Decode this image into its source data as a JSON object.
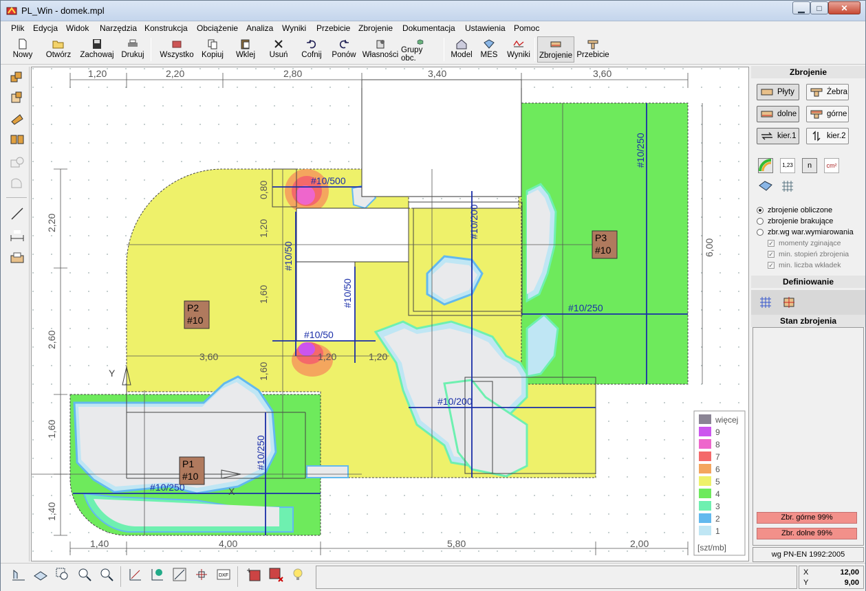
{
  "window": {
    "title": "PL_Win - domek.mpl",
    "min_glyph": "▁",
    "max_glyph": "□",
    "close_glyph": "✕"
  },
  "menu": [
    "Plik",
    "Edycja",
    "Widok",
    "Narzędzia",
    "Konstrukcja",
    "Obciążenie",
    "Analiza",
    "Wyniki",
    "Przebicie",
    "Zbrojenie",
    "Dokumentacja",
    "Ustawienia",
    "Pomoc"
  ],
  "toolbar": {
    "nowy": "Nowy",
    "otworz": "Otwórz",
    "zachowaj": "Zachowaj",
    "drukuj": "Drukuj",
    "wszystko": "Wszystko",
    "kopiuj": "Kopiuj",
    "wklej": "Wklej",
    "usun": "Usuń",
    "cofnij": "Cofnij",
    "ponow": "Ponów",
    "wlasnosci": "Własności",
    "grupy": "Grupy obc.",
    "model": "Model",
    "mes": "MES",
    "wyniki": "Wyniki",
    "zbrojenie": "Zbrojenie",
    "przebicie": "Przebicie"
  },
  "panel": {
    "title": "Zbrojenie",
    "plyty": "Płyty",
    "zebra": "Żebra",
    "dolne": "dolne",
    "gorne": "górne",
    "kier1": "kier.1",
    "kier2": "kier.2",
    "icon_123": "1,23",
    "icon_n": "n",
    "icon_cm2": "cm²",
    "radio_obliczone": "zbrojenie obliczone",
    "radio_brakujace": "zbrojenie brakujące",
    "radio_wymiarowania": "zbr.wg war.wymiarowania",
    "check_momenty": "momenty zginające",
    "check_stopien": "min. stopień zbrojenia",
    "check_wkladki": "min. liczba wkładek",
    "definiowanie": "Definiowanie",
    "stan": "Stan zbrojenia",
    "zbr_gorne": "Zbr. górne 99%",
    "zbr_dolne": "Zbr. dolne 99%",
    "norma": "wg PN-EN 1992:2005"
  },
  "drawing": {
    "top_dims": [
      "1,20",
      "2,20",
      "2,80",
      "3,40",
      "3,60"
    ],
    "bottom_dims": [
      "1,40",
      "4,00",
      "5,80",
      "2,00"
    ],
    "left_dims": [
      "2,20",
      "2,60",
      "1,60",
      "1,40"
    ],
    "inner_dims_v": [
      "0,80",
      "1,20",
      "1,60",
      "1,60"
    ],
    "inner_dims_h": [
      "3,60",
      "1,20",
      "1,20"
    ],
    "right_dim": "6,00",
    "plates": [
      {
        "name": "P1",
        "thick": "#10"
      },
      {
        "name": "P2",
        "thick": "#10"
      },
      {
        "name": "P3",
        "thick": "#10"
      }
    ],
    "rebar_labels": [
      "#10/500",
      "#10/50",
      "#10/50",
      "#10/50",
      "#10/200",
      "#10/200",
      "#10/250",
      "#10/250",
      "#10/250",
      "#10/250"
    ],
    "axis_x": "X",
    "axis_y": "Y",
    "legend_unit": "[szt/mb]",
    "legend": [
      {
        "label": "więcej",
        "color": "#8a8494"
      },
      {
        "label": "9",
        "color": "#cc55ee"
      },
      {
        "label": "8",
        "color": "#ee66cc"
      },
      {
        "label": "7",
        "color": "#f4696a"
      },
      {
        "label": "6",
        "color": "#f4a65e"
      },
      {
        "label": "5",
        "color": "#eef16a"
      },
      {
        "label": "4",
        "color": "#6eea5c"
      },
      {
        "label": "3",
        "color": "#6ef0b0"
      },
      {
        "label": "2",
        "color": "#62b9ee"
      },
      {
        "label": "1",
        "color": "#bfe6f4"
      }
    ]
  },
  "status": {
    "x_label": "X",
    "x_value": "12,00",
    "y_label": "Y",
    "y_value": "9,00"
  }
}
